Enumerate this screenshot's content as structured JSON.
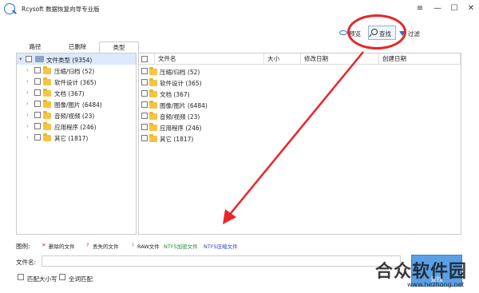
{
  "window": {
    "title": "Rcysoft 数据恢复向导专业版",
    "controls": [
      "—",
      "☐",
      "✕"
    ],
    "menu_glyph": "≡"
  },
  "toolbar": {
    "preview_label": "预览",
    "find_label": "查找",
    "filter_label": "过滤"
  },
  "tabs": [
    {
      "label": "路径",
      "active": false
    },
    {
      "label": "已删除",
      "active": false
    },
    {
      "label": "类型",
      "active": true
    }
  ],
  "tree": {
    "root": {
      "label": "文件类型 (9354)",
      "selected": true
    },
    "items": [
      {
        "label": "压缩/归档 (52)"
      },
      {
        "label": "软件设计 (365)"
      },
      {
        "label": "文档 (367)"
      },
      {
        "label": "图像/图片 (6484)"
      },
      {
        "label": "音频/视频 (23)"
      },
      {
        "label": "应用程序 (246)"
      },
      {
        "label": "其它 (1817)"
      }
    ]
  },
  "file_table": {
    "columns": [
      "文件名",
      "大小",
      "修改日期",
      "创建日期"
    ],
    "rows": [
      {
        "name": "压缩/归档 (52)"
      },
      {
        "name": "软件设计 (365)"
      },
      {
        "name": "文档 (367)"
      },
      {
        "name": "图像/图片 (6484)"
      },
      {
        "name": "音频/视频 (23)"
      },
      {
        "name": "应用程序 (246)"
      },
      {
        "name": "其它 (1817)"
      }
    ]
  },
  "legend": {
    "title": "图例:",
    "items": [
      {
        "mark": "✕",
        "label": "删除的文件",
        "color": "#d62b2b"
      },
      {
        "mark": "?",
        "label": "丢失的文件",
        "color": "#d62b2b"
      },
      {
        "mark": "!",
        "label": "RAW文件",
        "color": "#d62b2b"
      },
      {
        "mark": "",
        "label": "NTFS加密文件",
        "color": "#1f8a2e"
      },
      {
        "mark": "",
        "label": "NTFS压缩文件",
        "color": "#2b3fd6"
      }
    ]
  },
  "search": {
    "filename_label": "文件名:",
    "filename_value": "",
    "match_case_label": "匹配大小写",
    "match_whole_label": "全词匹配",
    "search_button_label": "查找"
  },
  "watermark": {
    "text": "合众软件园",
    "url": "www.hezhong.net"
  },
  "colors": {
    "highlight_red": "#e8262a",
    "accent_blue": "#5aa0e6"
  }
}
